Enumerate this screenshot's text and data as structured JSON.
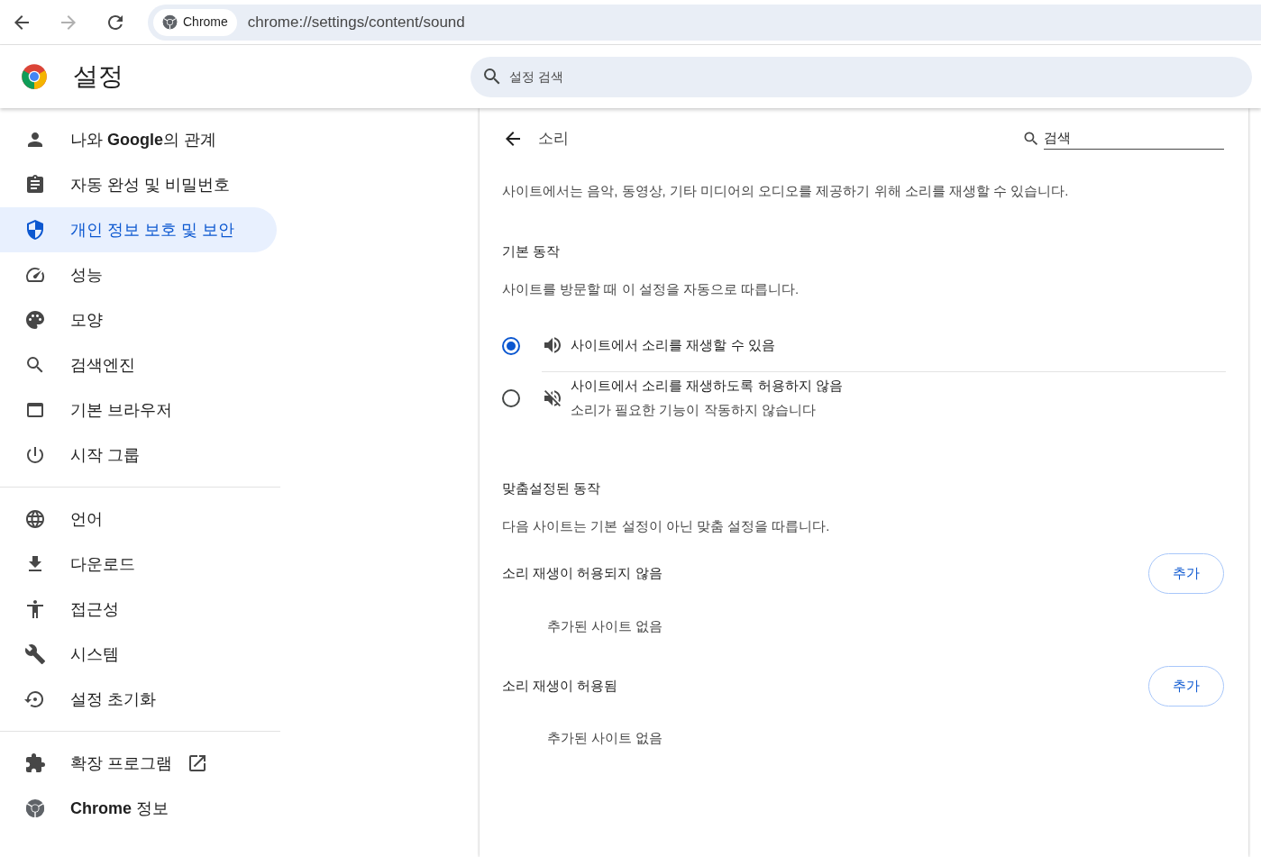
{
  "browser": {
    "chip": "Chrome",
    "url": "chrome://settings/content/sound"
  },
  "header": {
    "title": "설정",
    "search_placeholder": "설정 검색"
  },
  "sidebar": {
    "groups": [
      [
        {
          "label": "나와 **Google**의 관계",
          "selected": false,
          "kind": "page"
        },
        {
          "label": "자동 완성 및 비밀번호",
          "selected": false,
          "kind": "page"
        },
        {
          "label": "개인 정보 보호 및 보안",
          "selected": true,
          "kind": "page"
        },
        {
          "label": "성능",
          "selected": false,
          "kind": "page"
        },
        {
          "label": "모양",
          "selected": false,
          "kind": "page"
        },
        {
          "label": "검색엔진",
          "selected": false,
          "kind": "page"
        },
        {
          "label": "기본 브라우저",
          "selected": false,
          "kind": "page"
        },
        {
          "label": "시작 그룹",
          "selected": false,
          "kind": "page"
        }
      ],
      [
        {
          "label": "언어",
          "selected": false,
          "kind": "page"
        },
        {
          "label": "다운로드",
          "selected": false,
          "kind": "page"
        },
        {
          "label": "접근성",
          "selected": false,
          "kind": "page"
        },
        {
          "label": "시스템",
          "selected": false,
          "kind": "page"
        },
        {
          "label": "설정 초기화",
          "selected": false,
          "kind": "page"
        }
      ],
      [
        {
          "label": "확장 프로그램",
          "selected": false,
          "kind": "external"
        },
        {
          "label": "**Chrome** 정보",
          "selected": false,
          "kind": "page"
        }
      ]
    ]
  },
  "page": {
    "title": "소리",
    "search_placeholder": "검색",
    "description": "사이트에서는 음악, 동영상, 기타 미디어의 오디오를 제공하기 위해 소리를 재생할 수 있습니다.",
    "default_heading": "기본 동작",
    "default_description": "사이트를 방문할 때 이 설정을 자동으로 따릅니다.",
    "options": [
      {
        "label": "사이트에서 소리를 재생할 수 있음",
        "selected": true,
        "kind": "sound-on"
      },
      {
        "label": "사이트에서 소리를 재생하도록 허용하지 않음",
        "sublabel": "소리가 필요한 기능이 작동하지 않습니다",
        "selected": false,
        "kind": "sound-off"
      }
    ],
    "custom_heading": "맞춤설정된 동작",
    "custom_description": "다음 사이트는 기본 설정이 아닌 맞춤 설정을 따릅니다.",
    "lists": [
      {
        "title": "소리 재생이 허용되지 않음",
        "button": "추가",
        "empty": "추가된 사이트 없음"
      },
      {
        "title": "소리 재생이 허용됨",
        "button": "추가",
        "empty": "추가된 사이트 없음"
      }
    ]
  }
}
